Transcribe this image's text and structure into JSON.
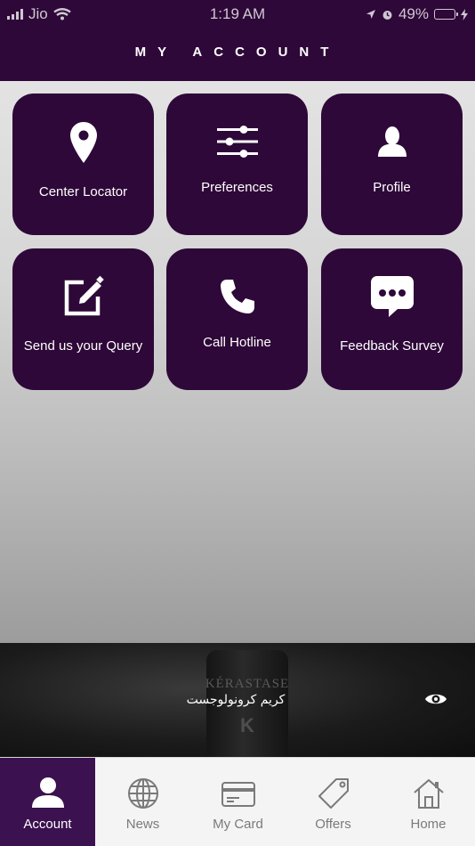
{
  "status_bar": {
    "carrier": "Jio",
    "time": "1:19 AM",
    "battery": "49%"
  },
  "header": {
    "title": "MY ACCOUNT"
  },
  "tiles": [
    {
      "label": "Center Locator",
      "icon": "map-pin-icon"
    },
    {
      "label": "Preferences",
      "icon": "sliders-icon"
    },
    {
      "label": "Profile",
      "icon": "user-icon"
    },
    {
      "label": "Send us your Query",
      "icon": "edit-icon"
    },
    {
      "label": "Call Hotline",
      "icon": "phone-icon"
    },
    {
      "label": "Feedback Survey",
      "icon": "chat-bubble-icon"
    }
  ],
  "banner": {
    "caption": "كريم كرونولوجست",
    "brand": "KÉRASTASE",
    "mark": "K",
    "icon": "eye-icon"
  },
  "tabbar": {
    "active": "Account",
    "tabs": [
      {
        "label": "Account",
        "icon": "person-icon"
      },
      {
        "label": "News",
        "icon": "globe-icon"
      },
      {
        "label": "My Card",
        "icon": "card-icon"
      },
      {
        "label": "Offers",
        "icon": "tag-icon"
      },
      {
        "label": "Home",
        "icon": "house-icon"
      }
    ]
  },
  "colors": {
    "primary": "#2e0838",
    "active_tab": "#3b1150",
    "battery": "#f5c400"
  }
}
